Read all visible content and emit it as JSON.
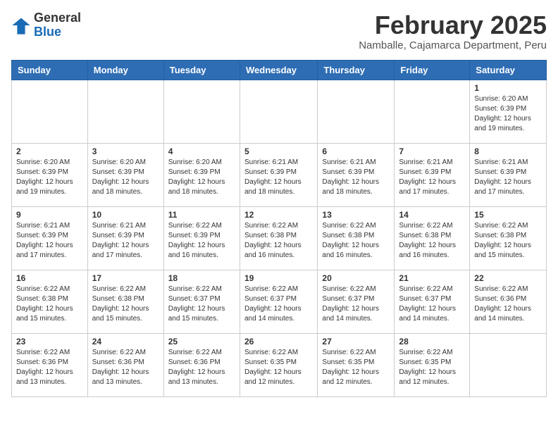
{
  "logo": {
    "general": "General",
    "blue": "Blue"
  },
  "header": {
    "title": "February 2025",
    "subtitle": "Namballe, Cajamarca Department, Peru"
  },
  "weekdays": [
    "Sunday",
    "Monday",
    "Tuesday",
    "Wednesday",
    "Thursday",
    "Friday",
    "Saturday"
  ],
  "weeks": [
    [
      {
        "day": "",
        "info": ""
      },
      {
        "day": "",
        "info": ""
      },
      {
        "day": "",
        "info": ""
      },
      {
        "day": "",
        "info": ""
      },
      {
        "day": "",
        "info": ""
      },
      {
        "day": "",
        "info": ""
      },
      {
        "day": "1",
        "info": "Sunrise: 6:20 AM\nSunset: 6:39 PM\nDaylight: 12 hours\nand 19 minutes."
      }
    ],
    [
      {
        "day": "2",
        "info": "Sunrise: 6:20 AM\nSunset: 6:39 PM\nDaylight: 12 hours\nand 19 minutes."
      },
      {
        "day": "3",
        "info": "Sunrise: 6:20 AM\nSunset: 6:39 PM\nDaylight: 12 hours\nand 18 minutes."
      },
      {
        "day": "4",
        "info": "Sunrise: 6:20 AM\nSunset: 6:39 PM\nDaylight: 12 hours\nand 18 minutes."
      },
      {
        "day": "5",
        "info": "Sunrise: 6:21 AM\nSunset: 6:39 PM\nDaylight: 12 hours\nand 18 minutes."
      },
      {
        "day": "6",
        "info": "Sunrise: 6:21 AM\nSunset: 6:39 PM\nDaylight: 12 hours\nand 18 minutes."
      },
      {
        "day": "7",
        "info": "Sunrise: 6:21 AM\nSunset: 6:39 PM\nDaylight: 12 hours\nand 17 minutes."
      },
      {
        "day": "8",
        "info": "Sunrise: 6:21 AM\nSunset: 6:39 PM\nDaylight: 12 hours\nand 17 minutes."
      }
    ],
    [
      {
        "day": "9",
        "info": "Sunrise: 6:21 AM\nSunset: 6:39 PM\nDaylight: 12 hours\nand 17 minutes."
      },
      {
        "day": "10",
        "info": "Sunrise: 6:21 AM\nSunset: 6:39 PM\nDaylight: 12 hours\nand 17 minutes."
      },
      {
        "day": "11",
        "info": "Sunrise: 6:22 AM\nSunset: 6:39 PM\nDaylight: 12 hours\nand 16 minutes."
      },
      {
        "day": "12",
        "info": "Sunrise: 6:22 AM\nSunset: 6:38 PM\nDaylight: 12 hours\nand 16 minutes."
      },
      {
        "day": "13",
        "info": "Sunrise: 6:22 AM\nSunset: 6:38 PM\nDaylight: 12 hours\nand 16 minutes."
      },
      {
        "day": "14",
        "info": "Sunrise: 6:22 AM\nSunset: 6:38 PM\nDaylight: 12 hours\nand 16 minutes."
      },
      {
        "day": "15",
        "info": "Sunrise: 6:22 AM\nSunset: 6:38 PM\nDaylight: 12 hours\nand 15 minutes."
      }
    ],
    [
      {
        "day": "16",
        "info": "Sunrise: 6:22 AM\nSunset: 6:38 PM\nDaylight: 12 hours\nand 15 minutes."
      },
      {
        "day": "17",
        "info": "Sunrise: 6:22 AM\nSunset: 6:38 PM\nDaylight: 12 hours\nand 15 minutes."
      },
      {
        "day": "18",
        "info": "Sunrise: 6:22 AM\nSunset: 6:37 PM\nDaylight: 12 hours\nand 15 minutes."
      },
      {
        "day": "19",
        "info": "Sunrise: 6:22 AM\nSunset: 6:37 PM\nDaylight: 12 hours\nand 14 minutes."
      },
      {
        "day": "20",
        "info": "Sunrise: 6:22 AM\nSunset: 6:37 PM\nDaylight: 12 hours\nand 14 minutes."
      },
      {
        "day": "21",
        "info": "Sunrise: 6:22 AM\nSunset: 6:37 PM\nDaylight: 12 hours\nand 14 minutes."
      },
      {
        "day": "22",
        "info": "Sunrise: 6:22 AM\nSunset: 6:36 PM\nDaylight: 12 hours\nand 14 minutes."
      }
    ],
    [
      {
        "day": "23",
        "info": "Sunrise: 6:22 AM\nSunset: 6:36 PM\nDaylight: 12 hours\nand 13 minutes."
      },
      {
        "day": "24",
        "info": "Sunrise: 6:22 AM\nSunset: 6:36 PM\nDaylight: 12 hours\nand 13 minutes."
      },
      {
        "day": "25",
        "info": "Sunrise: 6:22 AM\nSunset: 6:36 PM\nDaylight: 12 hours\nand 13 minutes."
      },
      {
        "day": "26",
        "info": "Sunrise: 6:22 AM\nSunset: 6:35 PM\nDaylight: 12 hours\nand 12 minutes."
      },
      {
        "day": "27",
        "info": "Sunrise: 6:22 AM\nSunset: 6:35 PM\nDaylight: 12 hours\nand 12 minutes."
      },
      {
        "day": "28",
        "info": "Sunrise: 6:22 AM\nSunset: 6:35 PM\nDaylight: 12 hours\nand 12 minutes."
      },
      {
        "day": "",
        "info": ""
      }
    ]
  ]
}
